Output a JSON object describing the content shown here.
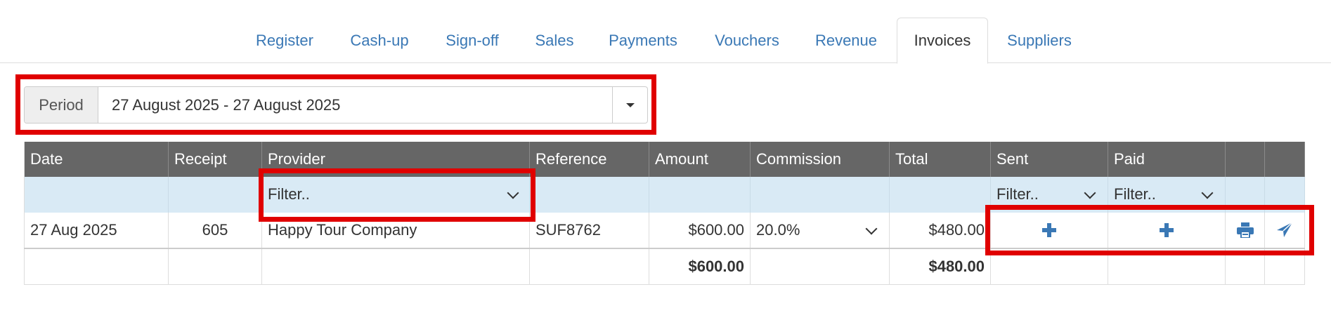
{
  "tabs": [
    {
      "label": "Register",
      "active": false
    },
    {
      "label": "Cash-up",
      "active": false
    },
    {
      "label": "Sign-off",
      "active": false
    },
    {
      "label": "Sales",
      "active": false
    },
    {
      "label": "Payments",
      "active": false
    },
    {
      "label": "Vouchers",
      "active": false
    },
    {
      "label": "Revenue",
      "active": false
    },
    {
      "label": "Invoices",
      "active": true
    },
    {
      "label": "Suppliers",
      "active": false
    }
  ],
  "period": {
    "label": "Period",
    "value": "27 August 2025 - 27 August 2025"
  },
  "table": {
    "columns": [
      "Date",
      "Receipt",
      "Provider",
      "Reference",
      "Amount",
      "Commission",
      "Total",
      "Sent",
      "Paid",
      "",
      ""
    ],
    "filters": {
      "provider": "Filter..",
      "sent": "Filter..",
      "paid": "Filter.."
    },
    "rows": [
      {
        "date": "27 Aug 2025",
        "receipt": "605",
        "provider": "Happy Tour Company",
        "reference": "SUF8762",
        "amount": "$600.00",
        "commission": "20.0%",
        "total": "$480.00",
        "sent_icon": "plus-icon",
        "paid_icon": "plus-icon",
        "print_icon": "printer-icon",
        "send_icon": "send-icon"
      }
    ],
    "totals": {
      "amount": "$600.00",
      "total": "$480.00"
    }
  },
  "colors": {
    "link": "#3a78b5",
    "header_bg": "#666666",
    "filter_bg": "#d9eaf5",
    "highlight": "#e00000"
  }
}
